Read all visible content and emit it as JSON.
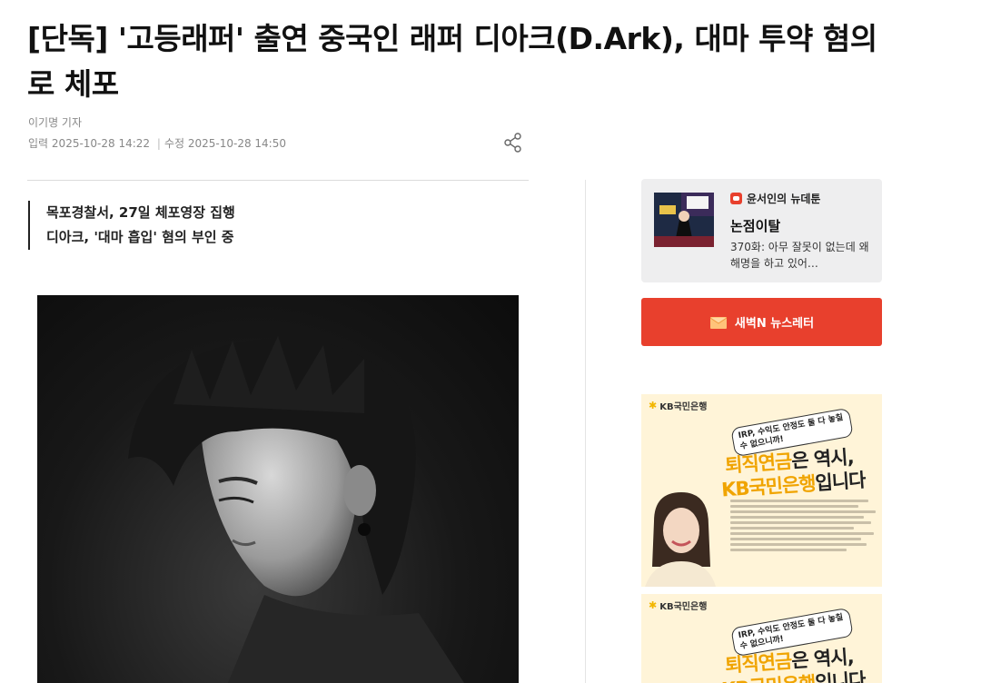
{
  "article": {
    "headline": "[단독] '고등래퍼' 출연 중국인 래퍼 디아크(D.Ark), 대마 투약 혐의로 체포",
    "reporter": "이기명 기자",
    "published_label": "입력",
    "published": "2025-10-28 14:22",
    "modified_label": "수정",
    "modified": "2025-10-28 14:50",
    "subheads": [
      "목포경찰서, 27일 체포영장 집행",
      "디아크, '대마 흡입' 혐의 부인 중"
    ]
  },
  "sidebar": {
    "webtoon": {
      "series": "윤서인의 뉴데툰",
      "title": "논점이탈",
      "desc": "370화: 아무 잘못이 없는데 왜 해명을 하고 있어…"
    },
    "newsletter_label": "새벽N 뉴스레터",
    "ads": [
      {
        "brand": "KB국민은행",
        "bubble": "IRP, 수익도 안정도 둘 다 놓칠 수 없으니까!",
        "line1_highlight": "퇴직연금",
        "line1_rest": "은 역시,",
        "line2_highlight": "KB국민은행",
        "line2_rest": "입니다"
      },
      {
        "brand": "KB국민은행",
        "bubble": "IRP, 수익도 안정도 둘 다 놓칠 수 없으니까!",
        "line1_highlight": "퇴직연금",
        "line1_rest": "은 역시,",
        "line2_highlight": "KB국민은행",
        "line2_rest": "입니다"
      }
    ]
  },
  "colors": {
    "accent": "#e8402d",
    "ad_yellow": "#f0a400",
    "panel_bg": "#eeeeef"
  }
}
